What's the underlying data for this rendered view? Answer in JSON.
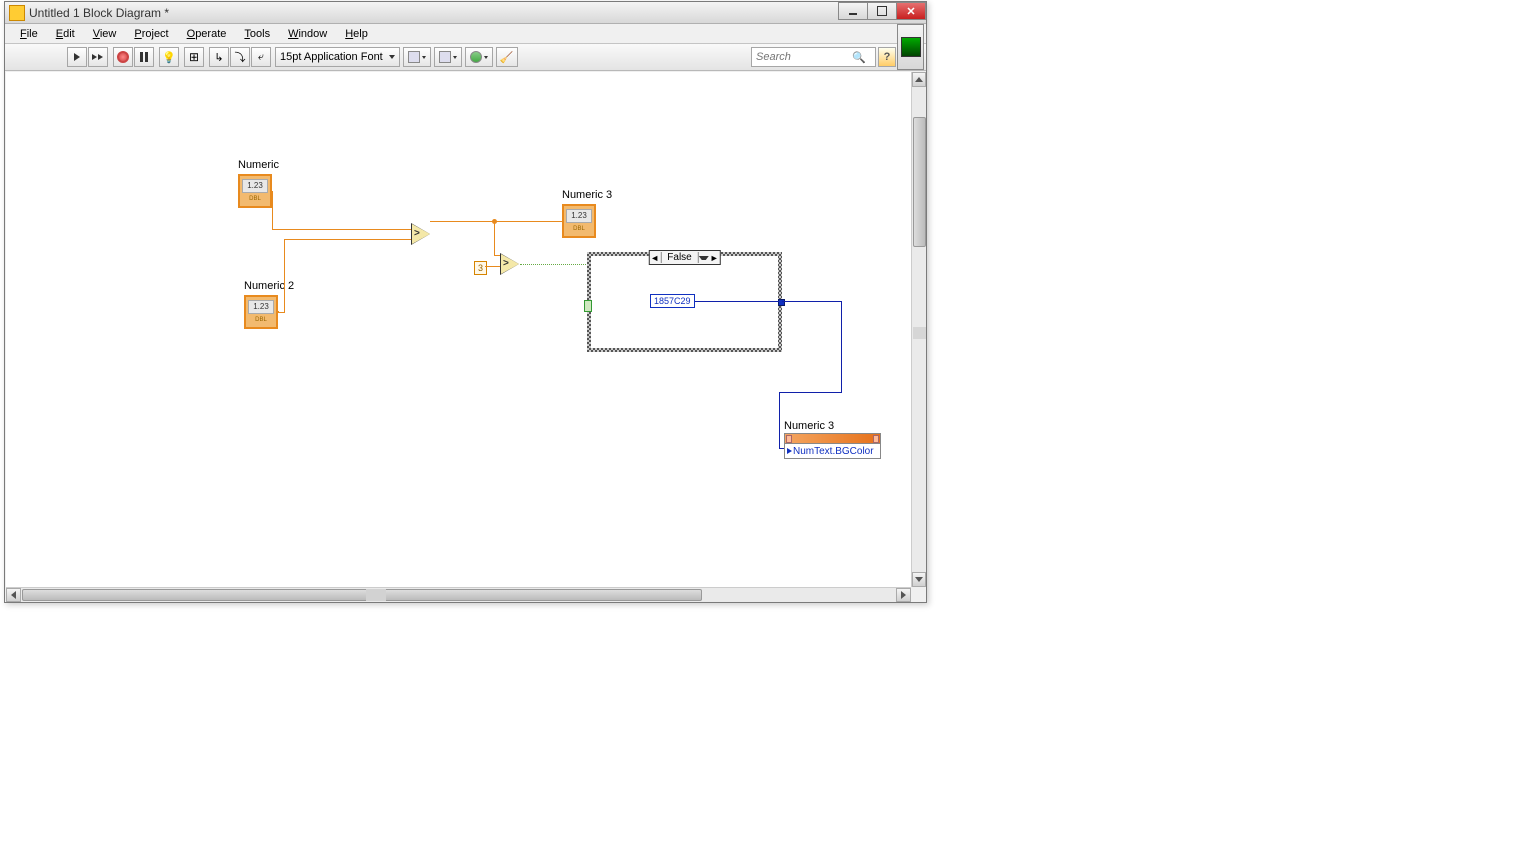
{
  "window": {
    "title": "Untitled 1 Block Diagram *",
    "icon_alt": "LV"
  },
  "menu": {
    "items": [
      "File",
      "Edit",
      "View",
      "Project",
      "Operate",
      "Tools",
      "Window",
      "Help"
    ]
  },
  "toolbar": {
    "font_selector": "15pt Application Font",
    "search_placeholder": "Search",
    "help_label": "?"
  },
  "diagram": {
    "numeric1": {
      "label": "Numeric",
      "val": "1.23",
      "type": "DBL"
    },
    "numeric2": {
      "label": "Numeric 2",
      "val": "1.23",
      "type": "DBL"
    },
    "numeric3": {
      "label": "Numeric 3",
      "val": "1.23",
      "type": "DBL"
    },
    "const3": "3",
    "case_value": "False",
    "color_const": "1857C29",
    "prop": {
      "label": "Numeric 3",
      "row": "NumText.BGColor"
    }
  }
}
